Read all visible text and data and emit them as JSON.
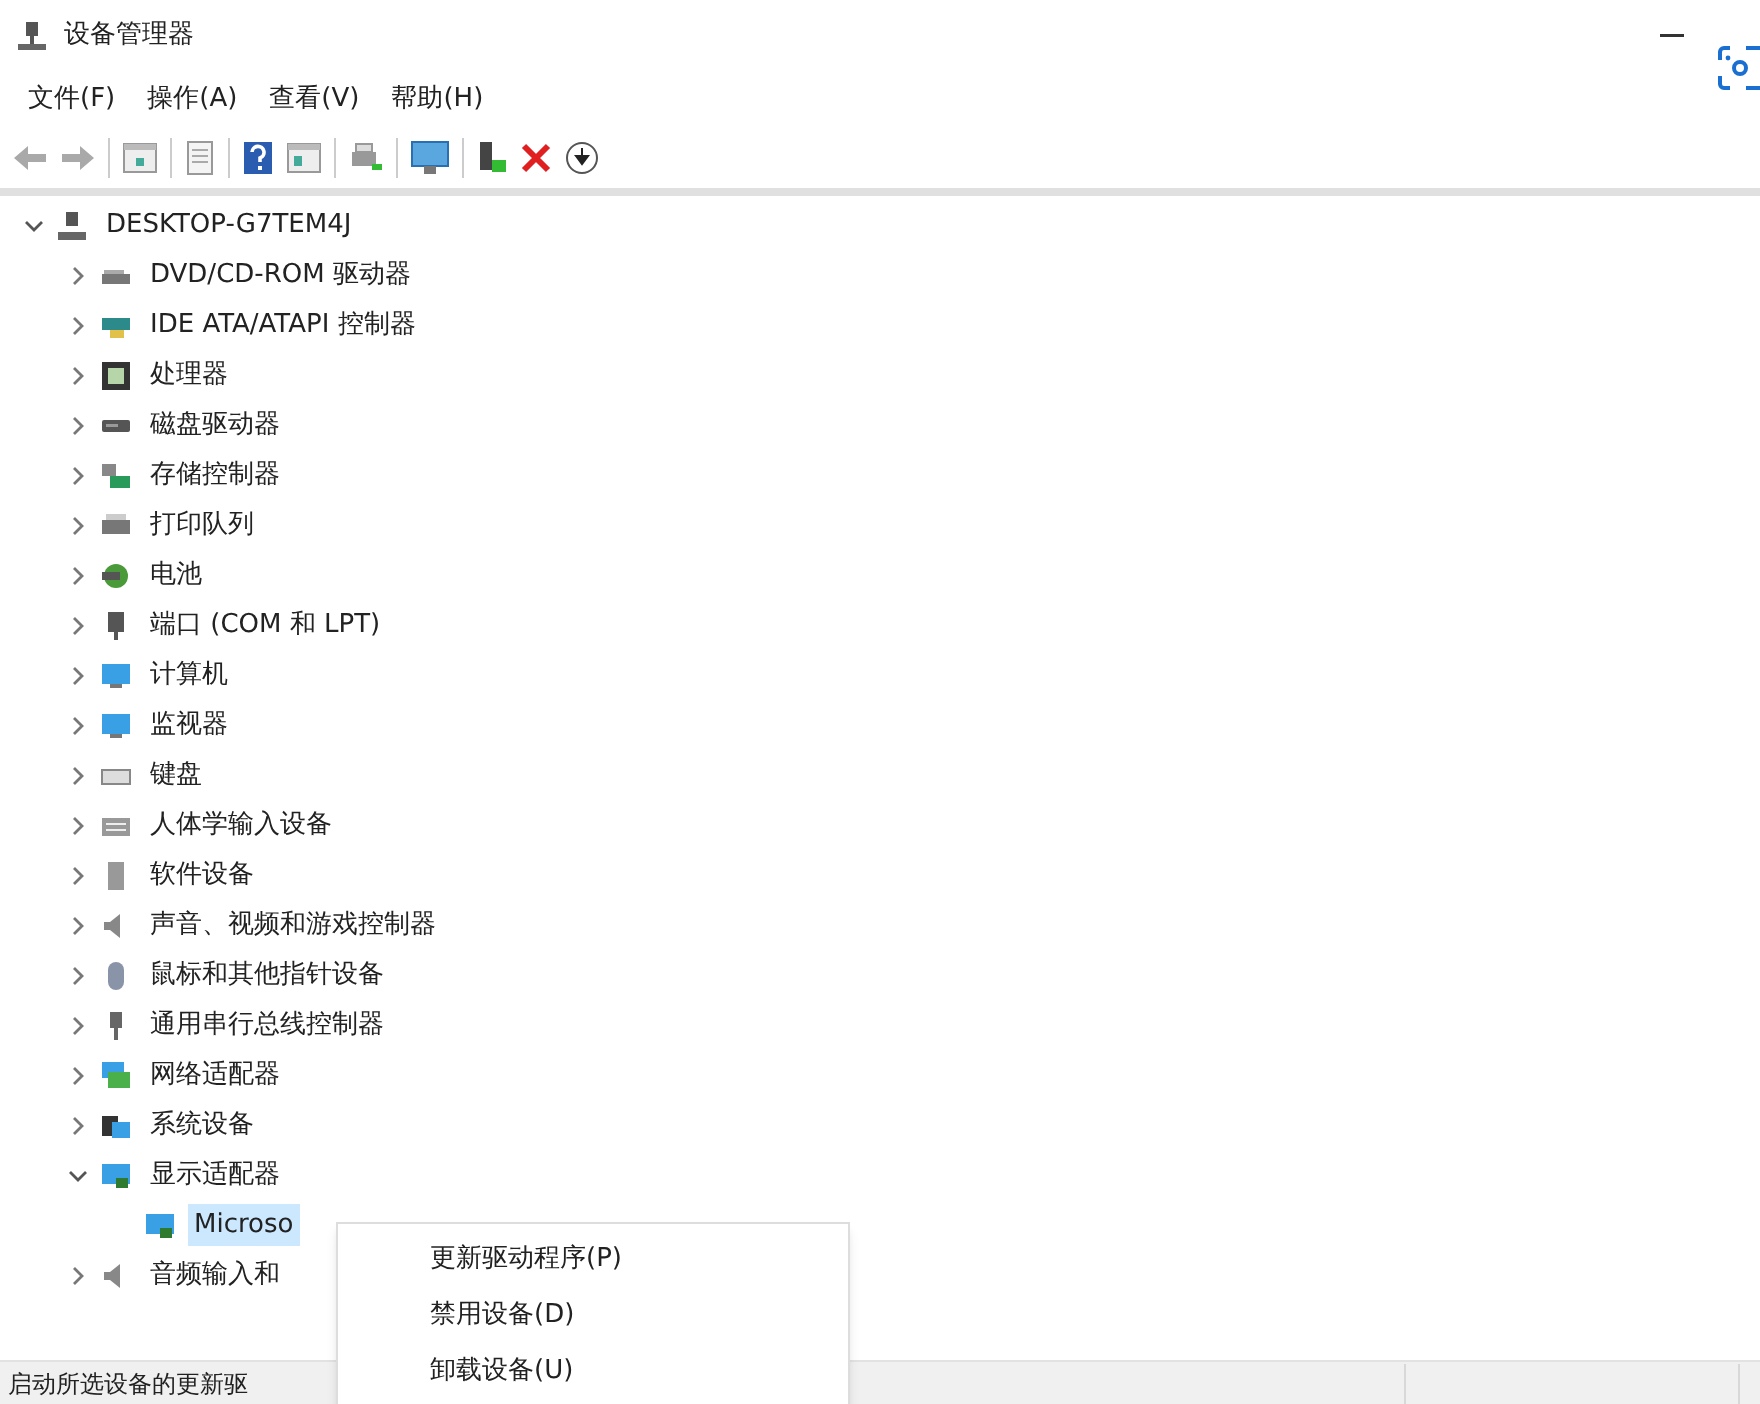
{
  "window": {
    "title": "设备管理器"
  },
  "menu": [
    "文件(F)",
    "操作(A)",
    "查看(V)",
    "帮助(H)"
  ],
  "tree": {
    "label": "DESKTOP-G7TEM4J",
    "expanded": true,
    "children": [
      {
        "label": "DVD/CD-ROM 驱动器",
        "expanded": false,
        "selected": false
      },
      {
        "label": "IDE ATA/ATAPI 控制器",
        "expanded": false,
        "selected": false
      },
      {
        "label": "处理器",
        "expanded": false,
        "selected": false
      },
      {
        "label": "磁盘驱动器",
        "expanded": false,
        "selected": false
      },
      {
        "label": "存储控制器",
        "expanded": false,
        "selected": false
      },
      {
        "label": "打印队列",
        "expanded": false,
        "selected": false
      },
      {
        "label": "电池",
        "expanded": false,
        "selected": false
      },
      {
        "label": "端口 (COM 和 LPT)",
        "expanded": false,
        "selected": false
      },
      {
        "label": "计算机",
        "expanded": false,
        "selected": false
      },
      {
        "label": "监视器",
        "expanded": false,
        "selected": false
      },
      {
        "label": "键盘",
        "expanded": false,
        "selected": false
      },
      {
        "label": "人体学输入设备",
        "expanded": false,
        "selected": false
      },
      {
        "label": "软件设备",
        "expanded": false,
        "selected": false
      },
      {
        "label": "声音、视频和游戏控制器",
        "expanded": false,
        "selected": false
      },
      {
        "label": "鼠标和其他指针设备",
        "expanded": false,
        "selected": false
      },
      {
        "label": "通用串行总线控制器",
        "expanded": false,
        "selected": false
      },
      {
        "label": "网络适配器",
        "expanded": false,
        "selected": false
      },
      {
        "label": "系统设备",
        "expanded": false,
        "selected": false
      },
      {
        "label": "显示适配器",
        "expanded": true,
        "selected": false,
        "children": [
          {
            "label": "Microso",
            "selected": true
          }
        ]
      },
      {
        "label": "音频输入和",
        "expanded": false,
        "selected": false
      }
    ]
  },
  "context_menu": [
    "更新驱动程序(P)",
    "禁用设备(D)",
    "卸载设备(U)"
  ],
  "status_bar": {
    "text": "启动所选设备的更新驱"
  }
}
